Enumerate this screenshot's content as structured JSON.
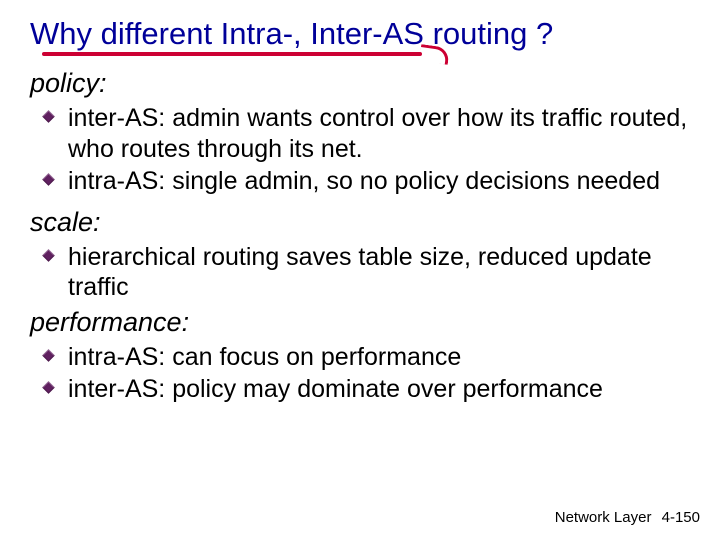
{
  "title": "Why different Intra-, Inter-AS routing ?",
  "sections": [
    {
      "heading": "policy:",
      "bullets": [
        "inter-AS: admin wants control over how its traffic routed, who routes through its net.",
        "intra-AS: single admin, so no policy decisions needed"
      ]
    },
    {
      "heading": "scale:",
      "bullets": [
        "hierarchical routing saves table size, reduced update traffic"
      ]
    },
    {
      "heading": "performance:",
      "bullets": [
        "intra-AS: can focus on performance",
        "inter-AS: policy may dominate over performance"
      ]
    }
  ],
  "footer": {
    "chapter": "Network Layer",
    "page": "4-150"
  }
}
